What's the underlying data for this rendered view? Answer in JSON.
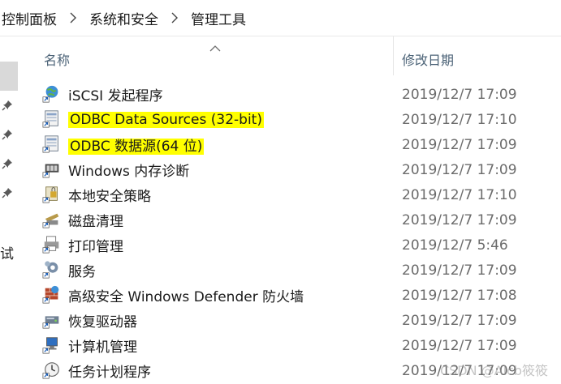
{
  "breadcrumb": [
    "控制面板",
    "系统和安全",
    "管理工具"
  ],
  "nav": {
    "partial_text": "试"
  },
  "columns": {
    "name": "名称",
    "date": "修改日期"
  },
  "rows": [
    {
      "name": "iSCSI 发起程序",
      "date": "2019/12/7 17:09",
      "icon": "globe-shortcut-icon",
      "highlighted": false
    },
    {
      "name": "ODBC Data Sources (32-bit)",
      "date": "2019/12/7 17:10",
      "icon": "odbc-shortcut-icon",
      "highlighted": true
    },
    {
      "name": "ODBC 数据源(64 位)",
      "date": "2019/12/7 17:09",
      "icon": "odbc-shortcut-icon",
      "highlighted": true
    },
    {
      "name": "Windows 内存诊断",
      "date": "2019/12/7 17:09",
      "icon": "memory-diagnostic-icon",
      "highlighted": false
    },
    {
      "name": "本地安全策略",
      "date": "2019/12/7 17:10",
      "icon": "security-policy-icon",
      "highlighted": false
    },
    {
      "name": "磁盘清理",
      "date": "2019/12/7 17:09",
      "icon": "disk-cleanup-icon",
      "highlighted": false
    },
    {
      "name": "打印管理",
      "date": "2019/12/7 5:46",
      "icon": "print-management-icon",
      "highlighted": false
    },
    {
      "name": "服务",
      "date": "2019/12/7 17:09",
      "icon": "services-gear-icon",
      "highlighted": false
    },
    {
      "name": "高级安全 Windows Defender 防火墙",
      "date": "2019/12/7 17:08",
      "icon": "firewall-icon",
      "highlighted": false
    },
    {
      "name": "恢复驱动器",
      "date": "2019/12/7 17:09",
      "icon": "recovery-drive-icon",
      "highlighted": false
    },
    {
      "name": "计算机管理",
      "date": "2019/12/7 17:09",
      "icon": "computer-management-icon",
      "highlighted": false
    },
    {
      "name": "任务计划程序",
      "date": "2019/12/7 17:09",
      "icon": "task-scheduler-icon",
      "highlighted": false
    }
  ],
  "watermark": "CSDN @Alcb筱筱"
}
